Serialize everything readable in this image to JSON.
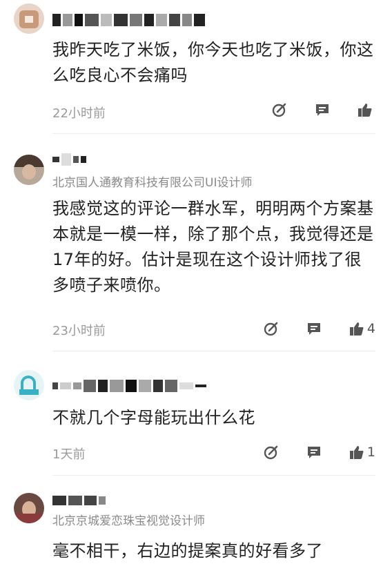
{
  "comments": [
    {
      "subtitle": "",
      "text": "我昨天吃了米饭，你今天也吃了米饭，你这么吃良心不会痛吗",
      "time": "22小时前",
      "likes": ""
    },
    {
      "subtitle": "北京国人通教育科技有限公司UI设计师",
      "text": "我感觉这的评论一群水军，明明两个方案基本就是一模一样，除了那个点，我觉得还是17年的好。估计是现在这个设计师找了很多喷子来喷你。",
      "time": "23小时前",
      "likes": "4"
    },
    {
      "subtitle": "",
      "text": "不就几个字母能玩出什么花",
      "time": "1天前",
      "likes": "1"
    },
    {
      "subtitle": "北京京城爱恋珠宝视觉设计师",
      "text": "毫不相干，右边的提案真的好看多了",
      "time": "",
      "likes": ""
    }
  ],
  "icons": {
    "reply": "edit-reply-icon",
    "comment": "chat-bubble-icon",
    "like": "thumbs-up-icon"
  }
}
